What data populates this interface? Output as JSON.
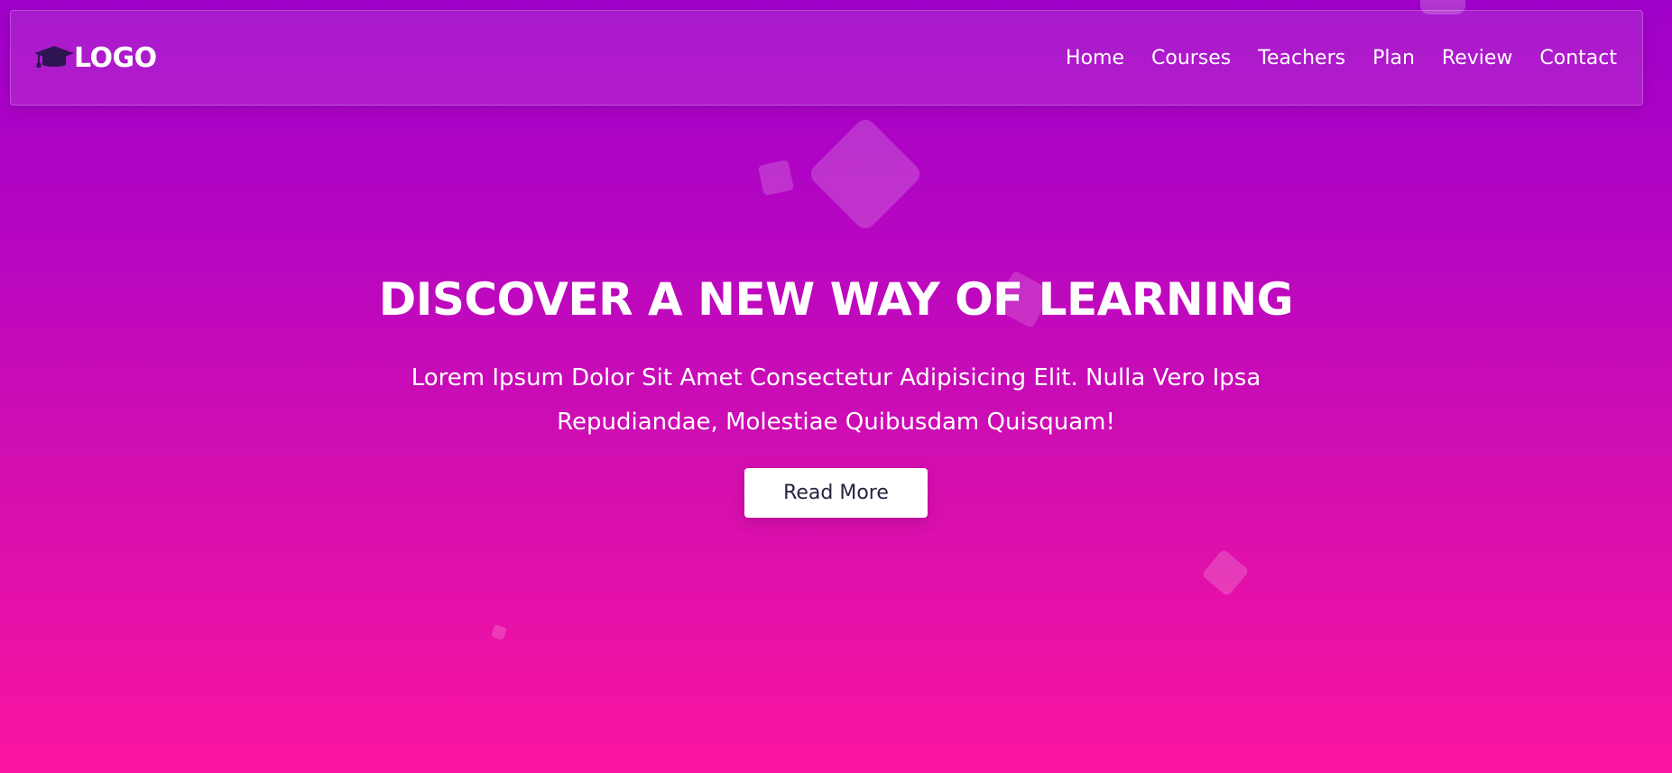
{
  "brand": {
    "logo_text": "LOGO",
    "logo_icon": "graduation-cap-icon"
  },
  "nav": {
    "items": [
      {
        "label": "Home"
      },
      {
        "label": "Courses"
      },
      {
        "label": "Teachers"
      },
      {
        "label": "Plan"
      },
      {
        "label": "Review"
      },
      {
        "label": "Contact"
      }
    ]
  },
  "hero": {
    "title": "DISCOVER A NEW WAY OF LEARNING",
    "description": "Lorem Ipsum Dolor Sit Amet Consectetur Adipisicing Elit. Nulla Vero Ipsa Repudiandae, Molestiae Quibusdam Quisquam!",
    "button_label": "Read More"
  },
  "colors": {
    "gradient_top": "#9f00c9",
    "gradient_bottom": "#fb14a0",
    "logo_icon": "#2d1552",
    "button_text": "#2a2140"
  }
}
